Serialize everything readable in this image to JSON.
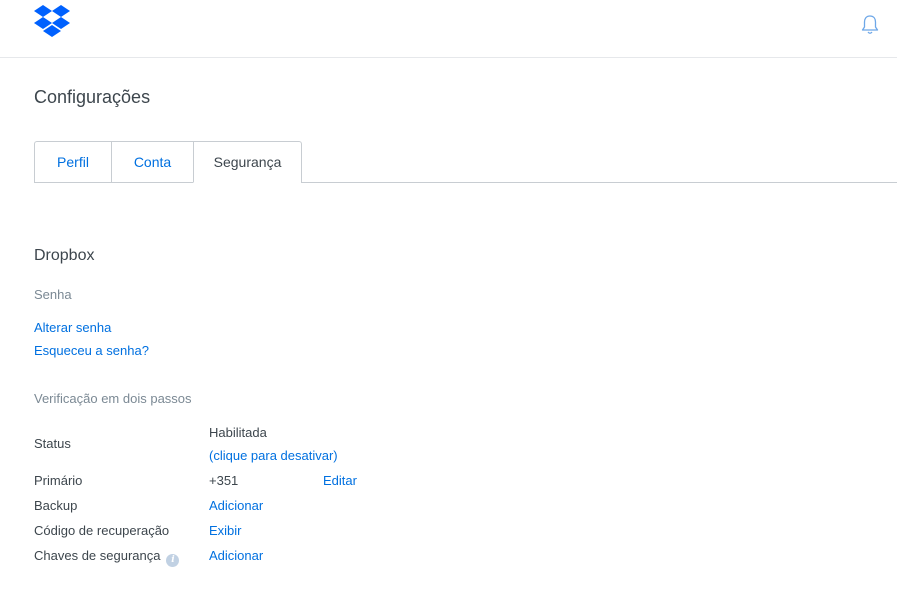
{
  "app": {
    "brand_color": "#0061fe",
    "link_color": "#0070e0",
    "icons": [
      "dropbox-logo-icon",
      "bell-icon",
      "info-icon"
    ]
  },
  "header": {
    "page_title": "Configurações"
  },
  "tabs": [
    {
      "label": "Perfil",
      "active": false
    },
    {
      "label": "Conta",
      "active": false
    },
    {
      "label": "Segurança",
      "active": true
    }
  ],
  "security": {
    "section_title": "Dropbox",
    "password": {
      "label": "Senha",
      "change_link": "Alterar senha",
      "forgot_link": "Esqueceu a senha?"
    },
    "two_step": {
      "label": "Verificação em dois passos",
      "rows": {
        "status": {
          "label": "Status",
          "value": "Habilitada",
          "action": "(clique para desativar)"
        },
        "primary": {
          "label": "Primário",
          "value": "+351",
          "action": "Editar"
        },
        "backup": {
          "label": "Backup",
          "action": "Adicionar"
        },
        "recovery": {
          "label": "Código de recuperação",
          "action": "Exibir"
        },
        "keys": {
          "label": "Chaves de segurança",
          "action": "Adicionar"
        }
      }
    }
  }
}
